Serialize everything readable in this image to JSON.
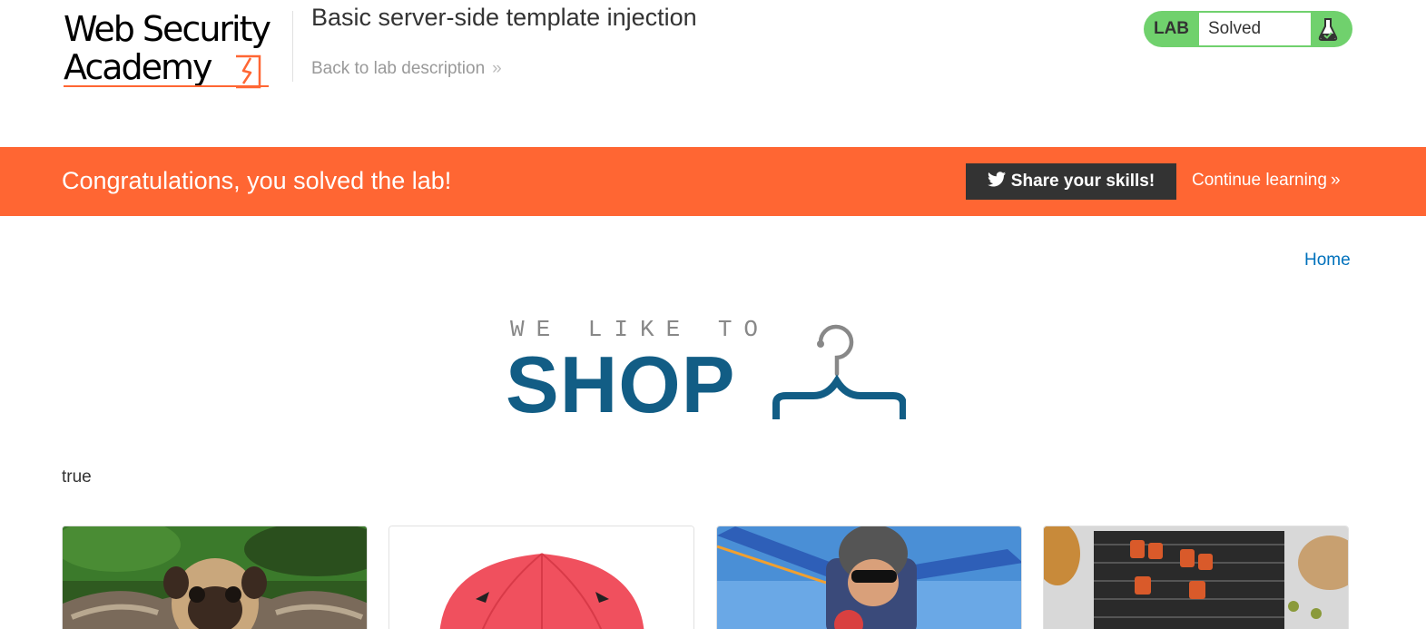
{
  "header": {
    "logo_line1": "Web Security",
    "logo_line2": "Academy",
    "lab_title": "Basic server-side template injection",
    "back_link": "Back to lab description",
    "status": {
      "badge": "LAB",
      "text": "Solved",
      "icon": "flask-icon",
      "color": "#70d16d"
    }
  },
  "banner": {
    "message": "Congratulations, you solved the lab!",
    "share_label": "Share your skills!",
    "share_icon": "twitter-icon",
    "continue_label": "Continue learning",
    "color": "#ff6633"
  },
  "nav": {
    "home_label": "Home"
  },
  "shop_logo": {
    "tagline": "WE LIKE TO",
    "word": "SHOP",
    "icon": "hanger-icon",
    "color": "#125d85"
  },
  "main": {
    "result_text": "true"
  },
  "products": [
    {
      "image": "pug-in-costume"
    },
    {
      "image": "red-umbrella"
    },
    {
      "image": "skydivers"
    },
    {
      "image": "grill-skewers"
    }
  ]
}
